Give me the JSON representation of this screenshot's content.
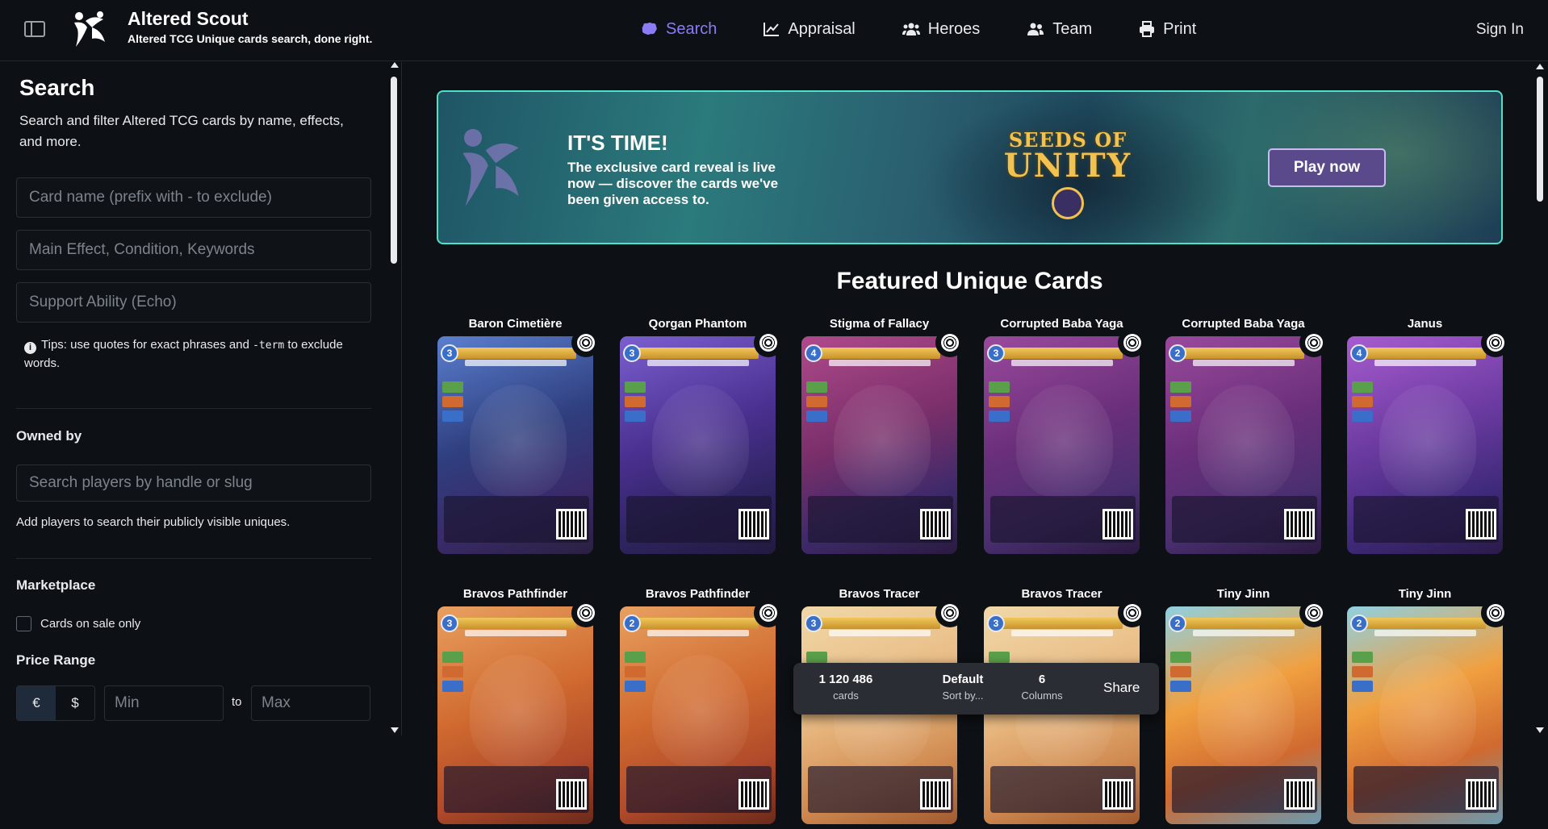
{
  "header": {
    "brand_title": "Altered Scout",
    "brand_subtitle": "Altered TCG Unique cards search, done right.",
    "nav": [
      {
        "label": "Search",
        "icon": "brain-icon",
        "active": true
      },
      {
        "label": "Appraisal",
        "icon": "chart-line-icon",
        "active": false
      },
      {
        "label": "Heroes",
        "icon": "users-icon",
        "active": false
      },
      {
        "label": "Team",
        "icon": "user-group-icon",
        "active": false
      },
      {
        "label": "Print",
        "icon": "printer-icon",
        "active": false
      }
    ],
    "sign_in": "Sign In"
  },
  "sidebar": {
    "title": "Search",
    "description": "Search and filter Altered TCG cards by name, effects, and more.",
    "card_name_placeholder": "Card name (prefix with - to exclude)",
    "main_effect_placeholder": "Main Effect, Condition, Keywords",
    "support_placeholder": "Support Ability (Echo)",
    "tip_before": "Tips: use quotes for exact phrases and ",
    "tip_code": "-term",
    "tip_after": " to exclude words.",
    "owned_by_heading": "Owned by",
    "players_placeholder": "Search players by handle or slug",
    "players_note": "Add players to search their publicly visible uniques.",
    "marketplace_heading": "Marketplace",
    "on_sale_label": "Cards on sale only",
    "price_heading": "Price Range",
    "currencies": [
      "€",
      "$"
    ],
    "min_placeholder": "Min",
    "to_label": "to",
    "max_placeholder": "Max"
  },
  "banner": {
    "heading": "IT'S TIME!",
    "text": "The exclusive card reveal is live now — discover the cards we've been given access to.",
    "logo_line1": "SEEDS OF",
    "logo_line2": "UNITY",
    "button": "Play now",
    "accent": "#4ee0c8"
  },
  "featured": {
    "title": "Featured Unique Cards",
    "cards": [
      {
        "name": "Baron Cimetière",
        "theme": "c-blue",
        "cost": "3"
      },
      {
        "name": "Qorgan Phantom",
        "theme": "c-purple",
        "cost": "3"
      },
      {
        "name": "Stigma of Fallacy",
        "theme": "c-pink",
        "cost": "4"
      },
      {
        "name": "Corrupted Baba Yaga",
        "theme": "c-magenta",
        "cost": "3"
      },
      {
        "name": "Corrupted Baba Yaga",
        "theme": "c-magenta",
        "cost": "2"
      },
      {
        "name": "Janus",
        "theme": "c-violet",
        "cost": "4"
      },
      {
        "name": "Bravos Pathfinder",
        "theme": "c-orange",
        "cost": "3"
      },
      {
        "name": "Bravos Pathfinder",
        "theme": "c-orange",
        "cost": "2"
      },
      {
        "name": "Bravos Tracer",
        "theme": "c-cream",
        "cost": "3"
      },
      {
        "name": "Bravos Tracer",
        "theme": "c-cream",
        "cost": "3"
      },
      {
        "name": "Tiny Jinn",
        "theme": "c-teal",
        "cost": "2"
      },
      {
        "name": "Tiny Jinn",
        "theme": "c-teal",
        "cost": "2"
      }
    ]
  },
  "status": {
    "count": "1 120 486",
    "count_label": "cards",
    "sort_value": "Default",
    "sort_label": "Sort by...",
    "columns_value": "6",
    "columns_label": "Columns",
    "share": "Share"
  },
  "colors": {
    "background": "#0d1014",
    "accent": "#8b7cf6",
    "button": "#5a4a8c"
  }
}
